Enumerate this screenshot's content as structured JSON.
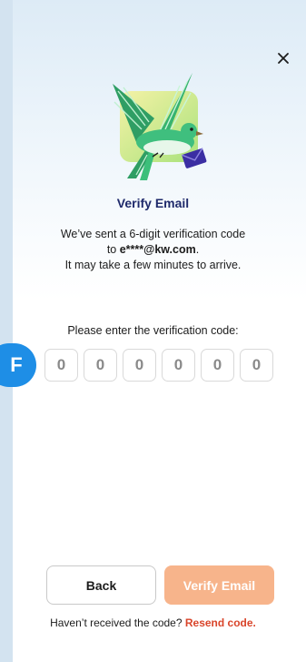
{
  "header": {
    "close_icon": "close-icon"
  },
  "illustration": {
    "icon": "bird-with-envelope-illustration",
    "accent": "#3cbf7a"
  },
  "title": "Verify Email",
  "description": {
    "line1": "We’ve sent a 6-digit verification code",
    "line2_prefix": "to ",
    "line2_email": "e****@kw.com",
    "line2_suffix": ".",
    "line3": "It may take a few minutes to arrive."
  },
  "code_prompt": "Please enter the verification code:",
  "code_digits": [
    "0",
    "0",
    "0",
    "0",
    "0",
    "0"
  ],
  "badge": {
    "label": "F",
    "color": "#1e8ee6"
  },
  "buttons": {
    "back_label": "Back",
    "verify_label": "Verify Email",
    "verify_color": "#f7b48b"
  },
  "resend": {
    "text": "Haven’t received the code? ",
    "link_label": "Resend code.",
    "link_color": "#d9452b"
  }
}
